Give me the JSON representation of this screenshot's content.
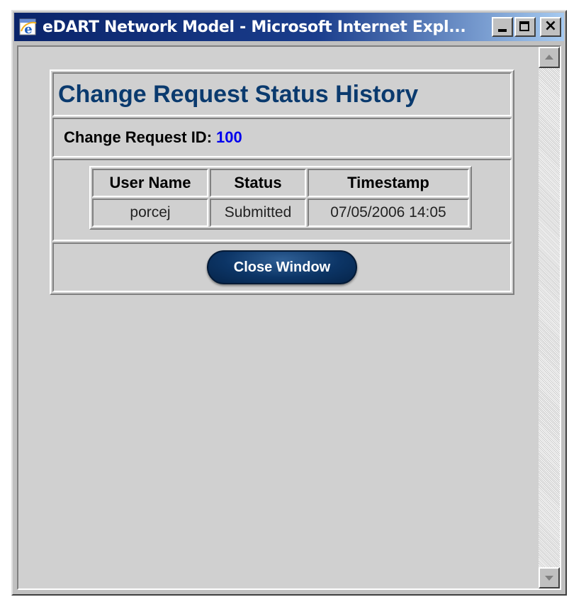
{
  "window": {
    "title": "eDART Network Model - Microsoft Internet Expl...",
    "icon": "internet-explorer-icon",
    "controls": {
      "minimize": "minimize-icon",
      "maximize": "maximize-icon",
      "close": "×"
    }
  },
  "page": {
    "title": "Change Request Status History",
    "id_label": "Change Request ID:",
    "id_value": "100"
  },
  "history_table": {
    "headers": [
      "User Name",
      "Status",
      "Timestamp"
    ],
    "rows": [
      [
        "porcej",
        "Submitted",
        "07/05/2006 14:05"
      ]
    ]
  },
  "actions": {
    "close_label": "Close Window"
  },
  "colors": {
    "title_text": "#0a3a6e",
    "id_value": "#0000ee",
    "button_bg": "#0c3566",
    "page_bg": "#d0d0d0"
  }
}
